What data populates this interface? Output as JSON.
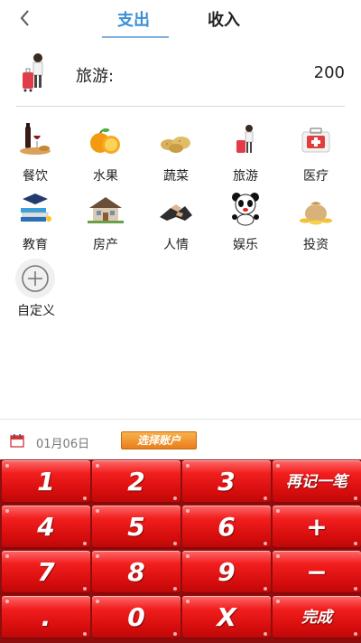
{
  "header": {
    "tabs": [
      {
        "label": "支出",
        "active": true
      },
      {
        "label": "收入",
        "active": false
      }
    ]
  },
  "selected": {
    "category": "旅游:",
    "amount": "200",
    "icon": "travel-icon"
  },
  "categories": [
    {
      "label": "餐饮",
      "icon": "wine-dining-icon"
    },
    {
      "label": "水果",
      "icon": "orange-fruit-icon"
    },
    {
      "label": "蔬菜",
      "icon": "potato-vegetable-icon"
    },
    {
      "label": "旅游",
      "icon": "traveler-suitcase-icon"
    },
    {
      "label": "医疗",
      "icon": "medical-kit-icon"
    },
    {
      "label": "教育",
      "icon": "books-graduation-cap-icon"
    },
    {
      "label": "房产",
      "icon": "house-icon"
    },
    {
      "label": "人情",
      "icon": "handshake-icon"
    },
    {
      "label": "娱乐",
      "icon": "panda-icon"
    },
    {
      "label": "投资",
      "icon": "money-bag-icon"
    }
  ],
  "custom": {
    "label": "自定义",
    "icon": "add-circle-icon"
  },
  "footer": {
    "date": "01月06日",
    "account_button": "选择账户"
  },
  "keypad": {
    "keys": [
      "1",
      "2",
      "3",
      "再记一笔",
      "4",
      "5",
      "6",
      "+",
      "7",
      "8",
      "9",
      "−",
      ".",
      "0",
      "X",
      "完成"
    ]
  },
  "colors": {
    "accent_blue": "#3b8fd9",
    "key_red": "#e01414",
    "account_orange": "#ef8a25"
  }
}
